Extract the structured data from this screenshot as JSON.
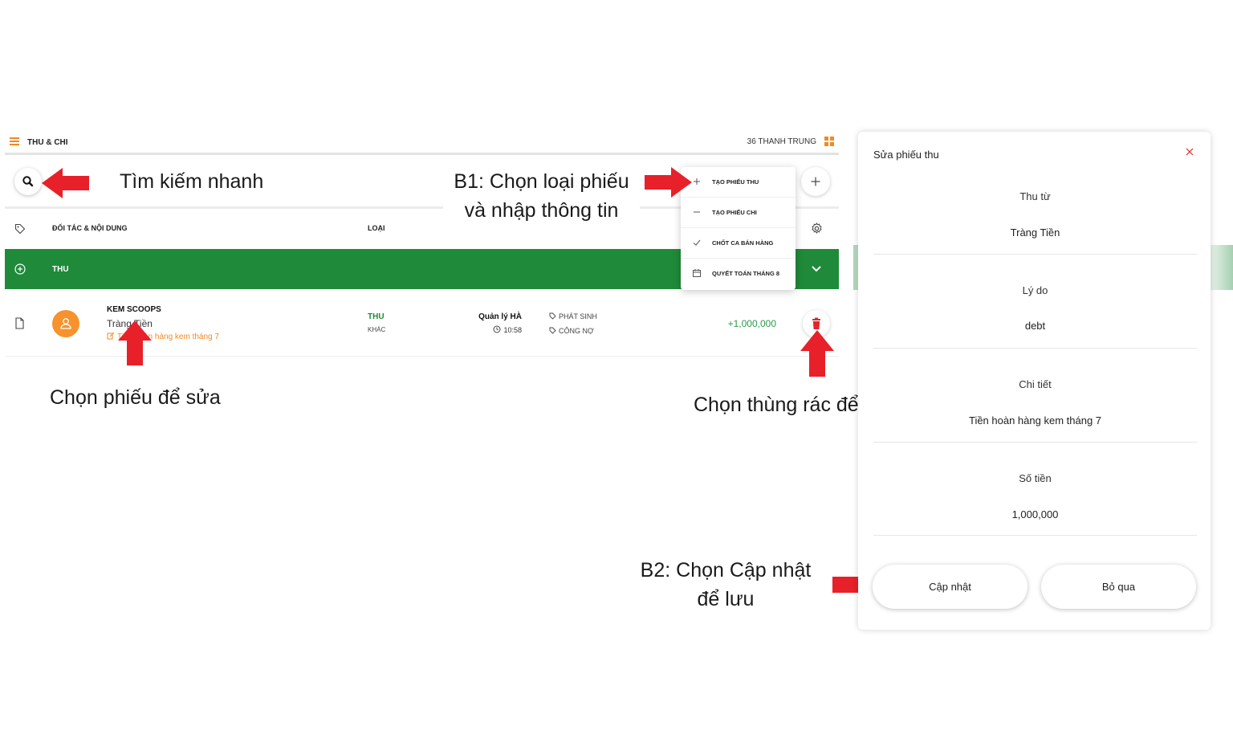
{
  "header": {
    "title": "THU & CHI",
    "store_name": "36 THANH TRUNG"
  },
  "table": {
    "col_partner": "ĐỐI TÁC & NỘI DUNG",
    "col_type": "LOẠI"
  },
  "group": {
    "label": "THU"
  },
  "row": {
    "partner": "KEM SCOOPS",
    "place": "Tràng Tiền",
    "note": "Tiền hoàn hàng kem tháng 7",
    "type": "THU",
    "subtype": "KHÁC",
    "manager": "Quản lý HÀ",
    "time": "10:58",
    "tag1": "PHÁT SINH",
    "tag2": "CÔNG NỢ",
    "amount": "+1,000,000"
  },
  "menu": {
    "items": [
      {
        "label": "TẠO PHIẾU THU",
        "icon": "plus-icon"
      },
      {
        "label": "TẠO PHIẾU CHI",
        "icon": "minus-icon"
      },
      {
        "label": "CHỐT CA BÁN HÀNG",
        "icon": "check-icon"
      },
      {
        "label": "QUYẾT TOÁN THÁNG 8",
        "icon": "calendar-icon"
      }
    ]
  },
  "annotations": {
    "search": "Tìm kiếm nhanh",
    "b1_line1": "B1: Chọn loại phiếu",
    "b1_line2": "và nhập thông tin",
    "select_edit": "Chọn phiếu để sửa",
    "trash_delete": "Chọn thùng rác để xoá",
    "b2_line1": "B2: Chọn Cập nhật",
    "b2_line2": "để lưu"
  },
  "panel": {
    "title": "Sửa phiếu thu",
    "fields": [
      {
        "label": "Thu từ",
        "value": "Tràng Tiền"
      },
      {
        "label": "Lý do",
        "value": "debt"
      },
      {
        "label": "Chi tiết",
        "value": "Tiền hoàn hàng kem tháng 7"
      },
      {
        "label": "Số tiền",
        "value": "1,000,000"
      }
    ],
    "update_label": "Cập nhật",
    "cancel_label": "Bỏ qua"
  },
  "colors": {
    "accent_orange": "#f08a24",
    "group_green": "#1f8a3a",
    "amount_green": "#2a9a4a",
    "trash_red": "#e0262b",
    "arrow_red": "#e8202a"
  }
}
